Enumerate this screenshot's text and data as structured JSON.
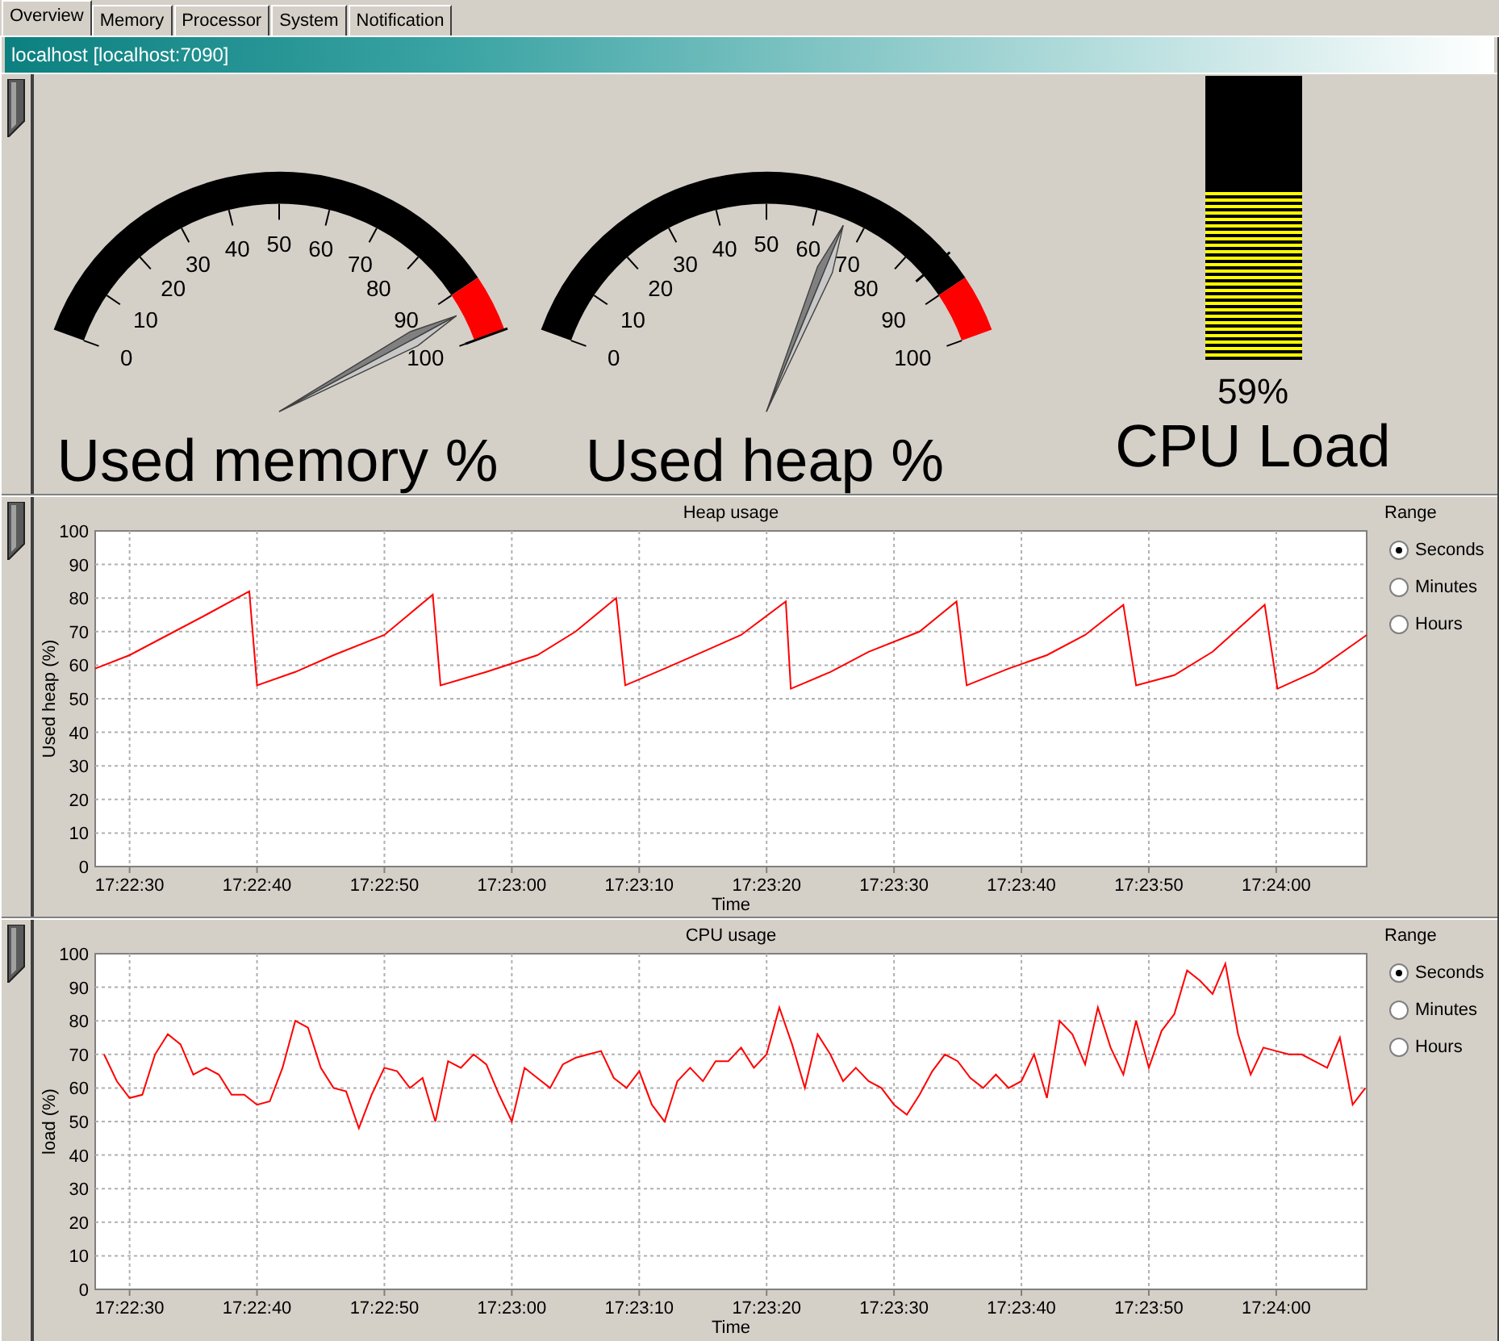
{
  "tabs": [
    {
      "label": "Overview",
      "selected": true
    },
    {
      "label": "Memory",
      "selected": false
    },
    {
      "label": "Processor",
      "selected": false
    },
    {
      "label": "System",
      "selected": false
    },
    {
      "label": "Notification",
      "selected": false
    }
  ],
  "header": {
    "title": "localhost [localhost:7090]"
  },
  "gauges": [
    {
      "title": "Used memory %",
      "level": 0.94,
      "peak": {
        "level": 1.0
      },
      "ticks": [
        "0",
        "10",
        "20",
        "30",
        "40",
        "50",
        "60",
        "70",
        "80",
        "90",
        "100"
      ]
    },
    {
      "title": "Used heap %",
      "level": 0.66,
      "peak": {
        "level": 0.85
      },
      "ticks": [
        "0",
        "10",
        "20",
        "30",
        "40",
        "50",
        "60",
        "70",
        "80",
        "90",
        "100"
      ]
    }
  ],
  "cpu_meter": {
    "title": "CPU Load",
    "level": 0.59,
    "reading": "59%"
  },
  "charts": [
    {
      "chart_data": {
        "type": "line",
        "grid": true,
        "title": "Heap usage",
        "xlabel": "Time",
        "ylabel": "Used heap (%)",
        "x": [
          62547.3,
          62550,
          62553,
          62556,
          62559.4,
          62560,
          62563,
          62566,
          62570,
          62573.8,
          62574.4,
          62578,
          62582,
          62585,
          62588.2,
          62588.9,
          62592,
          62595,
          62598,
          62601.5,
          62601.9,
          62605,
          62608,
          62612,
          62614.9,
          62615.7,
          62619,
          62622,
          62625,
          62628,
          62629,
          62632,
          62635,
          62639.1,
          62640.1,
          62643,
          62647.1
        ],
        "series": [
          {
            "color": "#ff0000",
            "values": [
              59,
              63,
              69,
              75,
              82,
              54,
              58,
              63,
              69,
              81,
              54,
              58,
              63,
              70,
              80,
              54,
              59,
              64,
              69,
              79,
              53,
              58,
              64,
              70,
              79,
              54,
              59,
              63,
              69,
              78,
              54,
              57,
              64,
              78,
              53,
              58,
              69
            ]
          }
        ],
        "xlim": [
          62547.3,
          62647.1
        ],
        "ylim": [
          0,
          100
        ],
        "xticks": [
          {
            "value": 62550,
            "label": "17:22:30"
          },
          {
            "value": 62560,
            "label": "17:22:40"
          },
          {
            "value": 62570,
            "label": "17:22:50"
          },
          {
            "value": 62580,
            "label": "17:23:00"
          },
          {
            "value": 62590,
            "label": "17:23:10"
          },
          {
            "value": 62600,
            "label": "17:23:20"
          },
          {
            "value": 62610,
            "label": "17:23:30"
          },
          {
            "value": 62620,
            "label": "17:23:40"
          },
          {
            "value": 62630,
            "label": "17:23:50"
          },
          {
            "value": 62640,
            "label": "17:24:00"
          }
        ],
        "yticks": [
          0,
          10,
          20,
          30,
          40,
          50,
          60,
          70,
          80,
          90,
          100
        ]
      },
      "range": {
        "title": "Range",
        "options": [
          {
            "label": "Seconds",
            "selected": true
          },
          {
            "label": "Minutes",
            "selected": false
          },
          {
            "label": "Hours",
            "selected": false
          }
        ]
      }
    },
    {
      "chart_data": {
        "type": "line",
        "grid": true,
        "title": "CPU usage",
        "xlabel": "Time",
        "ylabel": "load (%)",
        "x": [
          62548,
          62549,
          62550,
          62551,
          62552,
          62553,
          62554,
          62555,
          62556,
          62557,
          62558,
          62559,
          62560,
          62561,
          62562,
          62563,
          62564,
          62565,
          62566,
          62567,
          62568,
          62569,
          62570,
          62571,
          62572,
          62573,
          62574,
          62575,
          62576,
          62577,
          62578,
          62579,
          62580,
          62581,
          62582,
          62583,
          62584,
          62585,
          62586,
          62587,
          62588,
          62589,
          62590,
          62591,
          62592,
          62593,
          62594,
          62595,
          62596,
          62597,
          62598,
          62599,
          62600,
          62601,
          62602,
          62603,
          62604,
          62605,
          62606,
          62607,
          62608,
          62609,
          62610,
          62611,
          62612,
          62613,
          62614,
          62615,
          62616,
          62617,
          62618,
          62619,
          62620,
          62621,
          62622,
          62623,
          62624,
          62625,
          62626,
          62627,
          62628,
          62629,
          62630,
          62631,
          62632,
          62633,
          62634,
          62635,
          62636,
          62637,
          62638,
          62639,
          62640,
          62641,
          62642,
          62643,
          62644,
          62645,
          62646,
          62647
        ],
        "series": [
          {
            "color": "#ff0000",
            "values": [
              70,
              62,
              57,
              58,
              70,
              76,
              73,
              64,
              66,
              64,
              58,
              58,
              55,
              56,
              66,
              80,
              78,
              66,
              60,
              59,
              48,
              58,
              66,
              65,
              60,
              63,
              50,
              68,
              66,
              70,
              67,
              58,
              50,
              66,
              63,
              60,
              67,
              69,
              70,
              71,
              63,
              60,
              65,
              55,
              50,
              62,
              66,
              62,
              68,
              68,
              72,
              66,
              70,
              84,
              73,
              60,
              76,
              70,
              62,
              66,
              62,
              60,
              55,
              52,
              58,
              65,
              70,
              68,
              63,
              60,
              64,
              60,
              62,
              70,
              57,
              80,
              76,
              67,
              84,
              72,
              64,
              80,
              66,
              77,
              82,
              95,
              92,
              88,
              97,
              76,
              64,
              72,
              71,
              70,
              70,
              68,
              66,
              75,
              55,
              60
            ]
          }
        ],
        "xlim": [
          62547.3,
          62647.1
        ],
        "ylim": [
          0,
          100
        ],
        "xticks": [
          {
            "value": 62550,
            "label": "17:22:30"
          },
          {
            "value": 62560,
            "label": "17:22:40"
          },
          {
            "value": 62570,
            "label": "17:22:50"
          },
          {
            "value": 62580,
            "label": "17:23:00"
          },
          {
            "value": 62590,
            "label": "17:23:10"
          },
          {
            "value": 62600,
            "label": "17:23:20"
          },
          {
            "value": 62610,
            "label": "17:23:30"
          },
          {
            "value": 62620,
            "label": "17:23:40"
          },
          {
            "value": 62630,
            "label": "17:23:50"
          },
          {
            "value": 62640,
            "label": "17:24:00"
          }
        ],
        "yticks": [
          0,
          10,
          20,
          30,
          40,
          50,
          60,
          70,
          80,
          90,
          100
        ]
      },
      "range": {
        "title": "Range",
        "options": [
          {
            "label": "Seconds",
            "selected": true
          },
          {
            "label": "Minutes",
            "selected": false
          },
          {
            "label": "Hours",
            "selected": false
          }
        ]
      }
    }
  ]
}
